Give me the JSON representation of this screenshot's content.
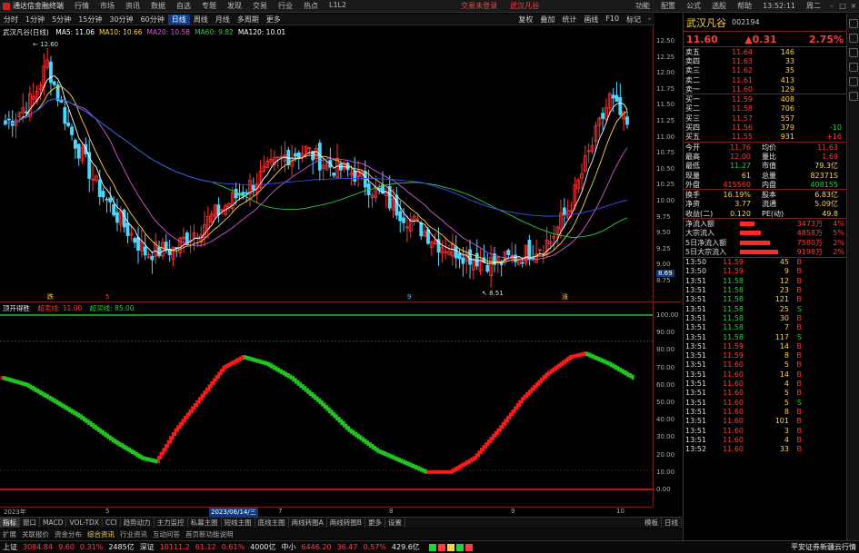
{
  "menubar": {
    "app_title": "通达信金融终端",
    "items": [
      "行情",
      "市场",
      "资讯",
      "数据",
      "自选",
      "专题",
      "发现",
      "交易",
      "行业",
      "热点",
      "L1L2"
    ],
    "center_left": "交易未登录",
    "center_right": "武汉凡谷",
    "right_items": [
      "功能",
      "配置",
      "公式",
      "选股",
      "帮助"
    ],
    "time": "13:52:11",
    "weekday": "周二"
  },
  "toolbar": {
    "items": [
      "分时",
      "1分钟",
      "5分钟",
      "15分钟",
      "30分钟",
      "60分钟",
      "日线",
      "周线",
      "月线",
      "多周期",
      "更多"
    ],
    "active": "日线",
    "right_items": [
      "复权",
      "叠加",
      "统计",
      "画线",
      "F10",
      "标记",
      "-"
    ]
  },
  "kchart": {
    "title": "武汉凡谷(日线)",
    "ma": [
      {
        "label": "MA5: 11.06",
        "color": "#ffffff"
      },
      {
        "label": "MA10: 10.66",
        "color": "#ffd24a"
      },
      {
        "label": "MA20: 10.58",
        "color": "#d35ad3"
      },
      {
        "label": "MA60: 9.82",
        "color": "#2ecc40"
      },
      {
        "label": "MA120: 10.01",
        "color": "#ffffff"
      }
    ],
    "high_label": "12.60",
    "low_label": "8.51",
    "price_axis": [
      "12.50",
      "12.25",
      "12.00",
      "11.75",
      "11.50",
      "11.25",
      "11.00",
      "10.75",
      "10.50",
      "10.25",
      "10.00",
      "9.75",
      "9.50",
      "9.25",
      "9.00",
      "8.75"
    ],
    "last_price_tag": "8.69",
    "bottom_markers": [
      "跌",
      "5",
      "9",
      "涨"
    ],
    "colors": {
      "up": "#ff3333",
      "down": "#4fd6ff",
      "ma5": "#ffffff",
      "ma10": "#ffd24a",
      "ma20": "#d35ad3",
      "ma60": "#2ecc40",
      "ma120": "#3b4ff5"
    }
  },
  "indicator": {
    "title": "顶开得胜",
    "p1": "超卖线: 11.00",
    "p2": "超买线: 85.00",
    "axis": [
      "100.00",
      "90.00",
      "80.00",
      "70.00",
      "60.00",
      "50.00",
      "40.00",
      "30.00",
      "20.00",
      "10.00",
      "0.00"
    ],
    "colors": {
      "up": "#ff1a1a",
      "down": "#22c422",
      "line": "#22c422"
    }
  },
  "datebar": {
    "items": [
      "2023年",
      "5",
      "2023/06/14/三",
      "7",
      "8",
      "9",
      "10"
    ]
  },
  "tabs": {
    "row1": [
      "指标",
      "窗口",
      "MACD",
      "VOL-TDX",
      "CCI",
      "趋势动力",
      "主力监控",
      "私募主图",
      "短线主图",
      "底线主图",
      "两线转图A",
      "两线转图B",
      "更多",
      "设置"
    ],
    "row1_right": [
      "模板",
      "日线"
    ],
    "row2": [
      "扩展",
      "关联报价",
      "资金分布",
      "综合资讯",
      "行业资讯",
      "互动问答",
      "首页新功能说明"
    ],
    "row2_active": "综合资讯"
  },
  "status": {
    "sh_label": "上证",
    "sh_value": "3084.84",
    "sh_chg": "9.60",
    "sh_pct": "0.31%",
    "sh_amt": "2485亿",
    "sz_label": "深证",
    "sz_value": "10111.2",
    "sz_chg": "61.12",
    "sz_pct": "0.61%",
    "sz_amt": "4000亿",
    "zx_label": "中小",
    "zx_value": "6446.20",
    "zx_chg": "36.47",
    "zx_pct": "0.57%",
    "zx_amt": "429.6亿",
    "broker": "平安证券新疆云行情"
  },
  "panel": {
    "name": "武汉凡谷",
    "code": "002194",
    "price": "11.60",
    "change": "▲0.31",
    "pct": "2.75%",
    "asks": [
      {
        "label": "卖五",
        "price": "11.64",
        "vol": "146"
      },
      {
        "label": "卖四",
        "price": "11.63",
        "vol": "33"
      },
      {
        "label": "卖三",
        "price": "11.62",
        "vol": "35"
      },
      {
        "label": "卖二",
        "price": "11.61",
        "vol": "413"
      },
      {
        "label": "卖一",
        "price": "11.60",
        "vol": "129"
      }
    ],
    "bids": [
      {
        "label": "买一",
        "price": "11.59",
        "vol": "408",
        "chg": ""
      },
      {
        "label": "买二",
        "price": "11.58",
        "vol": "706",
        "chg": ""
      },
      {
        "label": "买三",
        "price": "11.57",
        "vol": "557",
        "chg": ""
      },
      {
        "label": "买四",
        "price": "11.56",
        "vol": "379",
        "chg": "-10"
      },
      {
        "label": "买五",
        "price": "11.55",
        "vol": "931",
        "chg": "+16"
      }
    ],
    "stats": [
      {
        "k": "今开",
        "v": "11.76",
        "k2": "均价",
        "v2": "11.63"
      },
      {
        "k": "最高",
        "v": "12.00",
        "k2": "量比",
        "v2": "1.69"
      },
      {
        "k": "最低",
        "v": "11.27",
        "k2": "市值",
        "v2": "79.3亿"
      },
      {
        "k": "现量",
        "v": "61",
        "k2": "总量",
        "v2": "82371S"
      },
      {
        "k": "外盘",
        "v": "415560",
        "k2": "内盘",
        "v2": "408155"
      }
    ],
    "stats2": [
      {
        "k": "换手",
        "v": "16.19%",
        "k2": "股本",
        "v2": "6.83亿"
      },
      {
        "k": "净资",
        "v": "3.77",
        "k2": "流通",
        "v2": "5.09亿"
      },
      {
        "k": "收益(二)",
        "v": "0.120",
        "k2": "PE(动)",
        "v2": "49.8"
      }
    ],
    "flows": [
      {
        "k": "净流入额",
        "w": 0.26,
        "v": "3473万",
        "p": "4%"
      },
      {
        "k": "大宗流入",
        "w": 0.39,
        "v": "4858万",
        "p": "5%"
      },
      {
        "k": "5日净流入额",
        "w": 0.55,
        "v": "7580万",
        "p": "2%"
      },
      {
        "k": "5日大宗流入",
        "w": 0.7,
        "v": "9198万",
        "p": "2%"
      }
    ],
    "ticks": [
      {
        "t": "13:50",
        "p": "11.59",
        "v": "45",
        "bs": "B"
      },
      {
        "t": "13:50",
        "p": "11.59",
        "v": "9",
        "bs": "B"
      },
      {
        "t": "13:51",
        "p": "11.58",
        "v": "12",
        "bs": "B"
      },
      {
        "t": "13:51",
        "p": "11.58",
        "v": "23",
        "bs": "B"
      },
      {
        "t": "13:51",
        "p": "11.58",
        "v": "121",
        "bs": "B"
      },
      {
        "t": "13:51",
        "p": "11.58",
        "v": "25",
        "bs": "S"
      },
      {
        "t": "13:51",
        "p": "11.58",
        "v": "30",
        "bs": "B"
      },
      {
        "t": "13:51",
        "p": "11.58",
        "v": "7",
        "bs": "B"
      },
      {
        "t": "13:51",
        "p": "11.58",
        "v": "117",
        "bs": "S"
      },
      {
        "t": "13:51",
        "p": "11.59",
        "v": "14",
        "bs": "B"
      },
      {
        "t": "13:51",
        "p": "11.59",
        "v": "8",
        "bs": "B"
      },
      {
        "t": "13:51",
        "p": "11.60",
        "v": "5",
        "bs": "B"
      },
      {
        "t": "13:51",
        "p": "11.60",
        "v": "14",
        "bs": "B"
      },
      {
        "t": "13:51",
        "p": "11.60",
        "v": "4",
        "bs": "B"
      },
      {
        "t": "13:51",
        "p": "11.60",
        "v": "5",
        "bs": "B"
      },
      {
        "t": "13:51",
        "p": "11.60",
        "v": "5",
        "bs": "S"
      },
      {
        "t": "13:51",
        "p": "11.60",
        "v": "8",
        "bs": "B"
      },
      {
        "t": "13:51",
        "p": "11.60",
        "v": "101",
        "bs": "B"
      },
      {
        "t": "13:51",
        "p": "11.60",
        "v": "3",
        "bs": "B"
      },
      {
        "t": "13:51",
        "p": "11.60",
        "v": "4",
        "bs": "B"
      },
      {
        "t": "13:52",
        "p": "11.60",
        "v": "33",
        "bs": "B"
      }
    ]
  },
  "side_icons": [
    "trade-icon",
    "chart-icon",
    "news-icon",
    "flow-icon",
    "f10-icon",
    "more-icon"
  ]
}
